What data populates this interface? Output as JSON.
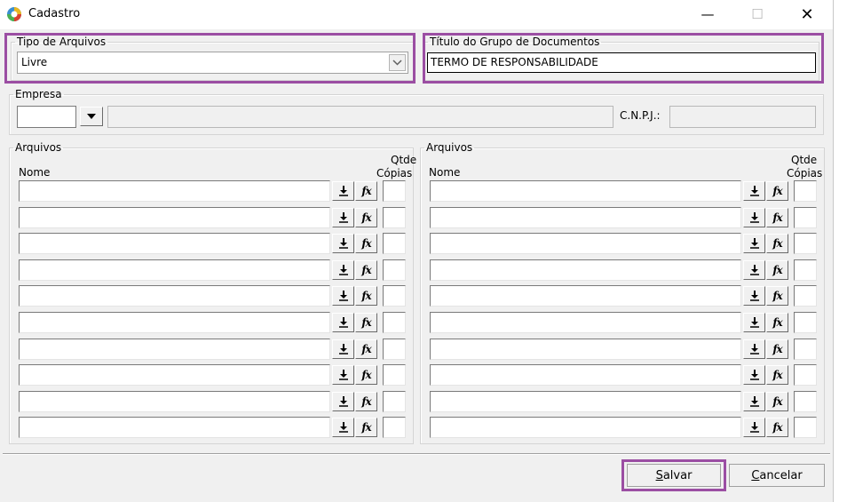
{
  "window": {
    "title": "Cadastro",
    "minimize": "—",
    "maximize": "☐",
    "close": "✕"
  },
  "tipo_arquivos": {
    "legend": "Tipo de Arquivos",
    "value": "Livre"
  },
  "titulo_grupo": {
    "legend": "Título do Grupo de Documentos",
    "value": "TERMO DE RESPONSABILIDADE"
  },
  "empresa": {
    "legend": "Empresa",
    "cnpj_label": "C.N.P.J.:",
    "code": "",
    "name": "",
    "cnpj": ""
  },
  "arquivos_left": {
    "legend": "Arquivos",
    "nome_header": "Nome",
    "qtde_header": "Qtde",
    "copias_header": "Cópias",
    "rows": 10
  },
  "arquivos_right": {
    "legend": "Arquivos",
    "nome_header": "Nome",
    "qtde_header": "Qtde",
    "copias_header": "Cópias",
    "rows": 10
  },
  "buttons": {
    "salvar": "Salvar",
    "salvar_mnemonic": "S",
    "salvar_rest": "alvar",
    "cancelar": "Cancelar",
    "cancelar_mnemonic": "C",
    "cancelar_rest": "ancelar"
  },
  "icons": {
    "download": "download-arrow-icon",
    "fx": "fx"
  },
  "colors": {
    "highlight": "#9b4ea3"
  }
}
